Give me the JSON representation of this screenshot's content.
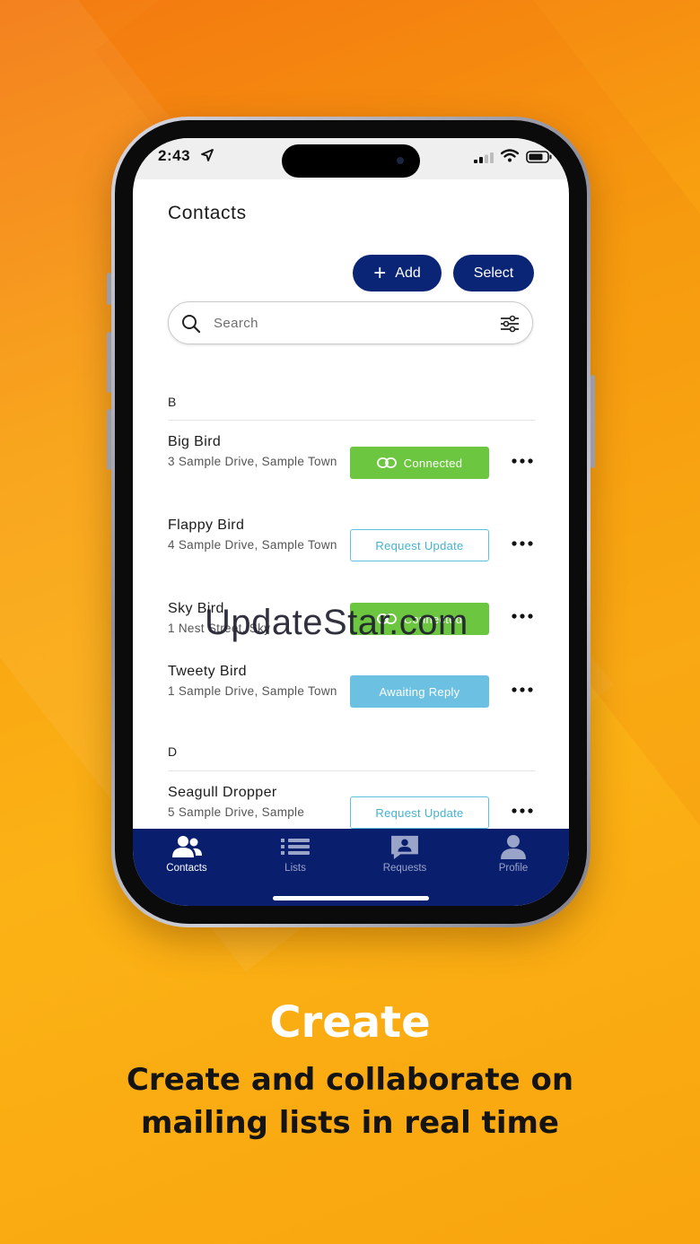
{
  "status_bar": {
    "time": "2:43"
  },
  "contacts_screen": {
    "title": "Contacts",
    "add_label": "Add",
    "select_label": "Select",
    "search_placeholder": "Search",
    "sections": [
      {
        "letter": "B",
        "contacts": [
          {
            "name": "Big Bird",
            "address": "3 Sample Drive, Sample Town",
            "status": "Connected"
          },
          {
            "name": "Flappy Bird",
            "address": "4 Sample Drive, Sample Town",
            "status": "Request Update"
          },
          {
            "name": "Sky Bird",
            "address": "1 Nest Street, Sky",
            "status": "Connected"
          },
          {
            "name": "Tweety Bird",
            "address": "1 Sample Drive, Sample Town",
            "status": "Awaiting Reply"
          }
        ]
      },
      {
        "letter": "D",
        "contacts": [
          {
            "name": "Seagull Dropper",
            "address": "5 Sample Drive, Sample",
            "status": "Request Update"
          }
        ]
      }
    ]
  },
  "tab_bar": {
    "tabs": [
      {
        "label": "Contacts",
        "icon": "contacts-icon",
        "active": true
      },
      {
        "label": "Lists",
        "icon": "list-icon",
        "active": false
      },
      {
        "label": "Requests",
        "icon": "requests-icon",
        "active": false
      },
      {
        "label": "Profile",
        "icon": "profile-icon",
        "active": false
      }
    ]
  },
  "watermark": "UpdateStar.com",
  "hero": {
    "title": "Create",
    "subtitle_line1": "Create and collaborate on",
    "subtitle_line2": "mailing lists in real time"
  },
  "colors": {
    "navy": "#0a2476",
    "tab_bar": "#0a1e6e",
    "connected_green": "#6cc63f",
    "request_outline": "#5fc2dc",
    "awaiting_blue": "#6cc1e2",
    "background_orange": "#f8a010"
  }
}
